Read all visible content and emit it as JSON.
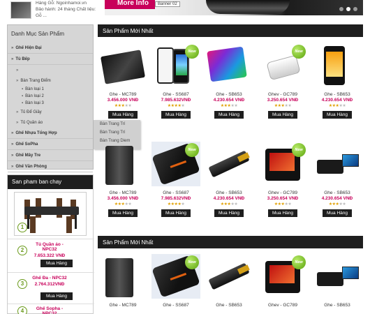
{
  "top": {
    "news_title": "Hàng Gỗ: Ngoinhamoi.vn",
    "news_text": "Bảo hành: 24 tháng Chất liệu: Gỗ ...",
    "banner_button": "More Info",
    "banner_label": "Banner 02"
  },
  "sidebar": {
    "title": "Danh Mục Sản Phẩm",
    "items": [
      {
        "label": "Ghế Hiện Đại",
        "level": 1
      },
      {
        "label": "Tủ Bếp",
        "level": 1
      },
      {
        "label": "",
        "level": 2
      },
      {
        "label": "Bàn Trang Điểm",
        "level": 2
      },
      {
        "label": "Bàn loại 1",
        "level": 3
      },
      {
        "label": "Bàn loại 2",
        "level": 3
      },
      {
        "label": "Bàn loại 3",
        "level": 3
      },
      {
        "label": "Tủ Để Giầy",
        "level": 2
      },
      {
        "label": "Tủ Quần áo",
        "level": 2
      },
      {
        "label": "Ghế Nhựa Tổng Hợp",
        "level": 1
      },
      {
        "label": "Ghế SoPha",
        "level": 1
      },
      {
        "label": "Ghế Mây Tre",
        "level": 1
      },
      {
        "label": "Ghế Văn Phòng",
        "level": 1
      }
    ],
    "flyout": [
      "Bàn Trang Trí",
      "Bàn Trang Trí",
      "Bàn Trang Diem"
    ]
  },
  "bestsellers": {
    "title": "San pham ban chay",
    "items": [
      {
        "num": "1"
      },
      {
        "num": "2",
        "name": "Tủ Quần áo - NPC32",
        "price": "7.653.322 VNĐ",
        "button": "Mua Hàng"
      },
      {
        "num": "3",
        "name": "Ghế Đa - NPC32",
        "price": "2.764.312VNĐ",
        "button": "Mua Hàng"
      },
      {
        "num": "4",
        "name": "Ghế Sopha - NPC32"
      }
    ]
  },
  "sections": [
    {
      "title": "Sản Phẩm Mới Nhất",
      "rows": [
        [
          {
            "name": "Ghe - MC789",
            "price": "3.456.000 VNĐ",
            "stars": 3,
            "button": "Mua Hàng",
            "new": false,
            "img": "wallet"
          },
          {
            "name": "Ghe - SS687",
            "price": "7.985.632VNĐ",
            "stars": 4,
            "button": "Mua Hàng",
            "new": true,
            "img": "phones"
          },
          {
            "name": "Ghe - SB653",
            "price": "4.230.654 VNĐ",
            "stars": 3,
            "button": "Mua Hàng",
            "new": false,
            "img": "tablet"
          },
          {
            "name": "Ghev - GC789",
            "price": "3.250.654 VNĐ",
            "stars": 3,
            "button": "Mua Hàng",
            "new": true,
            "img": "camera"
          },
          {
            "name": "Ghe - SB653",
            "price": "4.230.654 VNĐ",
            "stars": 3,
            "button": "Mua Hàng",
            "new": false,
            "img": "droid"
          }
        ],
        [
          {
            "name": "Ghe - MC789",
            "price": "3.456.000 VNĐ",
            "stars": 3,
            "button": "Mua Hàng",
            "new": false,
            "img": "slab"
          },
          {
            "name": "Ghe - SS687",
            "price": "7.985.632VNĐ",
            "stars": 4,
            "button": "Mua Hàng",
            "new": true,
            "img": "router"
          },
          {
            "name": "Ghe - SB653",
            "price": "4.230.654 VNĐ",
            "stars": 3,
            "button": "Mua Hàng",
            "new": false,
            "img": "usb"
          },
          {
            "name": "Ghev - GC789",
            "price": "3.250.654 VNĐ",
            "stars": 3,
            "button": "Mua Hàng",
            "new": true,
            "img": "projector"
          },
          {
            "name": "Ghe - SB653",
            "price": "4.230.654 VNĐ",
            "stars": 3,
            "button": "Mua Hàng",
            "new": false,
            "img": "camcorder"
          }
        ]
      ]
    },
    {
      "title": "Sản Phẩm Mới Nhất",
      "rows": [
        [
          {
            "name": "Ghe - MC789",
            "price": "",
            "new": false,
            "img": "slab"
          },
          {
            "name": "Ghe - SS687",
            "price": "",
            "new": true,
            "img": "router"
          },
          {
            "name": "Ghe - SB653",
            "price": "",
            "new": false,
            "img": "usb"
          },
          {
            "name": "Ghev - GC789",
            "price": "",
            "new": true,
            "img": "projector"
          },
          {
            "name": "Ghe - SB653",
            "price": "",
            "new": false,
            "img": "camcorder"
          }
        ]
      ]
    }
  ],
  "new_badge": "New",
  "colors": {
    "accent": "#c8005a",
    "dark": "#1e1e1e",
    "sidebar": "#d6d6d6",
    "stars": "#e0a000",
    "badge": "#6ab61e"
  }
}
